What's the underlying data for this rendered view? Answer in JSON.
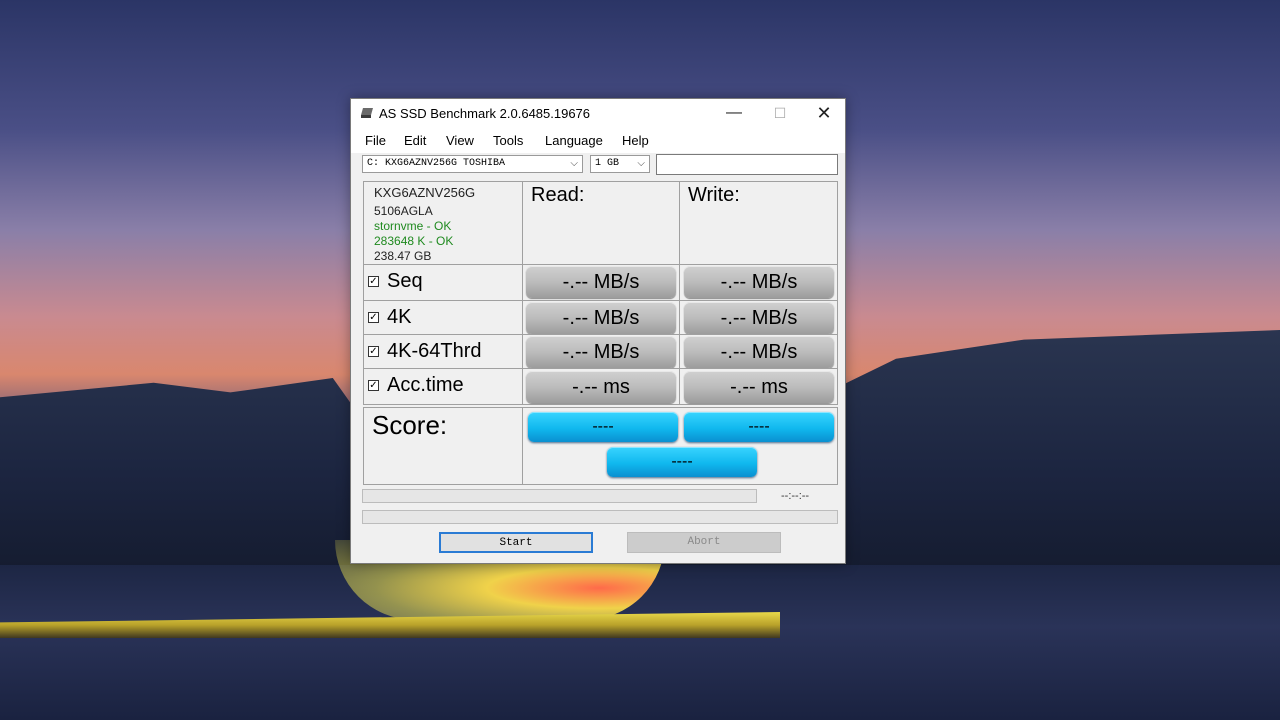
{
  "window": {
    "title": "AS SSD Benchmark 2.0.6485.19676",
    "controls": {
      "minimize": "—",
      "maximize": "☐",
      "close": "✕"
    }
  },
  "menu": {
    "items": [
      "File",
      "Edit",
      "View",
      "Tools",
      "Language",
      "Help"
    ]
  },
  "toolbar": {
    "drive_select": "C: KXG6AZNV256G TOSHIBA",
    "size_select": "1 GB",
    "text_field": ""
  },
  "drive_info": {
    "model": "KXG6AZNV256G",
    "firmware": "5106AGLA",
    "driver": "stornvme - OK",
    "alignment": "283648 K - OK",
    "capacity": "238.47 GB"
  },
  "columns": {
    "read": "Read:",
    "write": "Write:"
  },
  "rows": [
    {
      "label": "Seq",
      "checked": "☑",
      "read": "-.-- MB/s",
      "write": "-.-- MB/s"
    },
    {
      "label": "4K",
      "checked": "☑",
      "read": "-.-- MB/s",
      "write": "-.-- MB/s"
    },
    {
      "label": "4K-64Thrd",
      "checked": "☑",
      "read": "-.-- MB/s",
      "write": "-.-- MB/s"
    },
    {
      "label": "Acc.time",
      "checked": "☑",
      "read": "-.-- ms",
      "write": "-.-- ms"
    }
  ],
  "score": {
    "label": "Score:",
    "read": "----",
    "write": "----",
    "total": "----"
  },
  "progress": {
    "timer": "--:--:--"
  },
  "buttons": {
    "start": "Start",
    "abort": "Abort"
  },
  "colors": {
    "score_button": "#10b8ee",
    "value_button": "#bcbcbc",
    "ok_text": "#1f8a1f"
  },
  "icons": {
    "app": "disk-icon",
    "dropdown": "chevron-down-icon"
  }
}
